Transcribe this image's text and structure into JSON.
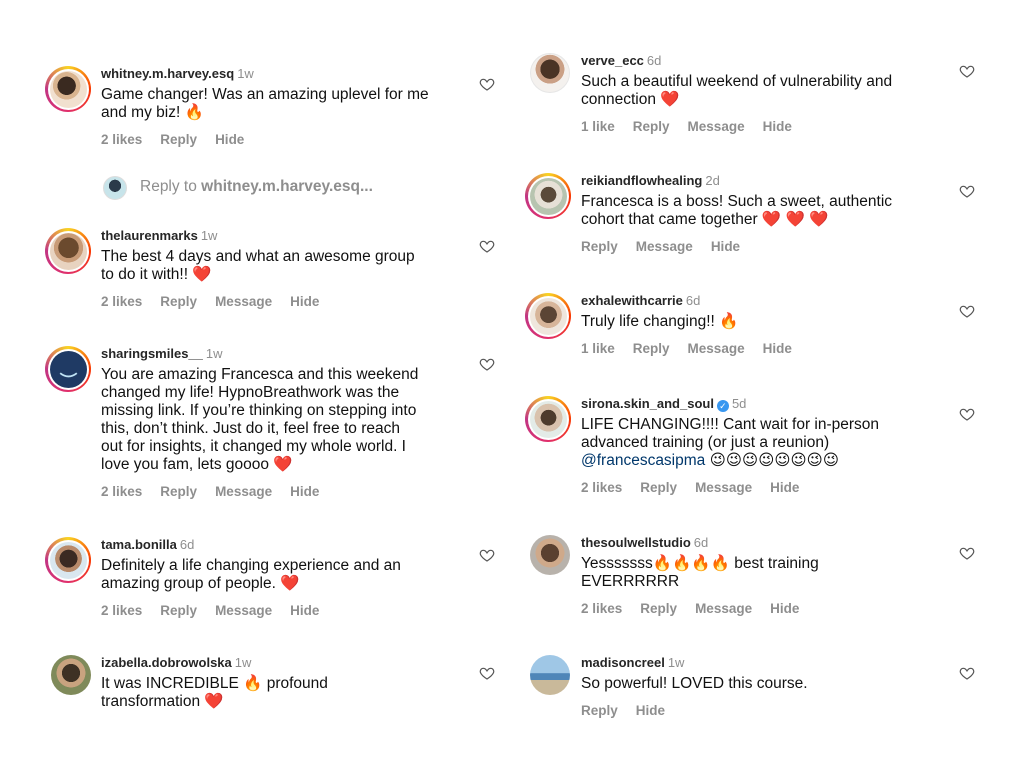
{
  "left": [
    {
      "user": "whitney.m.harvey.esq",
      "time": "1w",
      "text": "Game changer! Was an amazing uplevel for me\nand my biz! 🔥",
      "likes": "2 likes",
      "reply": "Reply",
      "message": "",
      "hide": "Hide"
    },
    {
      "user": "thelaurenmarks",
      "time": "1w",
      "text": "The best 4 days and what an awesome group\nto do it with!! ❤️",
      "likes": "2 likes",
      "reply": "Reply",
      "message": "Message",
      "hide": "Hide"
    },
    {
      "user": "sharingsmiles__",
      "time": "1w",
      "text": "You are amazing Francesca and this weekend\nchanged my life! HypnoBreathwork was the\nmissing link. If you’re thinking on stepping into\nthis, don’t think. Just do it, feel free to reach\nout for insights, it changed my whole world. I\nlove you fam, lets goooo ❤️",
      "likes": "2 likes",
      "reply": "Reply",
      "message": "Message",
      "hide": "Hide"
    },
    {
      "user": "tama.bonilla",
      "time": "6d",
      "text": "Definitely a life changing experience and an\namazing group of people. ❤️",
      "likes": "2 likes",
      "reply": "Reply",
      "message": "Message",
      "hide": "Hide"
    },
    {
      "user": "izabella.dobrowolska",
      "time": "1w",
      "text": "It was INCREDIBLE 🔥 profound\ntransformation ❤️",
      "likes": "",
      "reply": "",
      "message": "",
      "hide": ""
    }
  ],
  "reply_box": {
    "prefix": "Reply to ",
    "target": "whitney.m.harvey.esq..."
  },
  "right": [
    {
      "user": "verve_ecc",
      "time": "6d",
      "text": "Such a beautiful weekend of vulnerability and\nconnection ❤️",
      "likes": "1 like",
      "reply": "Reply",
      "message": "Message",
      "hide": "Hide"
    },
    {
      "user": "reikiandflowhealing",
      "time": "2d",
      "text": "Francesca is a boss! Such a sweet, authentic\ncohort that came together ❤️ ❤️ ❤️",
      "likes": "",
      "reply": "Reply",
      "message": "Message",
      "hide": "Hide"
    },
    {
      "user": "exhalewithcarrie",
      "time": "6d",
      "text": "Truly life changing!! 🔥",
      "likes": "1 like",
      "reply": "Reply",
      "message": "Message",
      "hide": "Hide"
    },
    {
      "user": "sirona.skin_and_soul",
      "time": "5d",
      "text": "LIFE CHANGING!!!! Cant wait for in-person\nadvanced training (or just a reunion)",
      "mention": "@francescasipma",
      "emoji_tail": " 😉😉😉😉😉😉😉😉",
      "likes": "2 likes",
      "reply": "Reply",
      "message": "Message",
      "hide": "Hide"
    },
    {
      "user": "thesoulwellstudio",
      "time": "6d",
      "text": "Yesssssss🔥🔥🔥🔥 best training\nEVERRRRRR",
      "likes": "2 likes",
      "reply": "Reply",
      "message": "Message",
      "hide": "Hide"
    },
    {
      "user": "madisoncreel",
      "time": "1w",
      "text": "So powerful! LOVED this course.",
      "likes": "",
      "reply": "Reply",
      "message": "",
      "hide": "Hide"
    }
  ],
  "colors": {
    "username": "#262626",
    "secondary": "#8e8e8e",
    "mention": "#00376b",
    "verified": "#3897f0"
  }
}
